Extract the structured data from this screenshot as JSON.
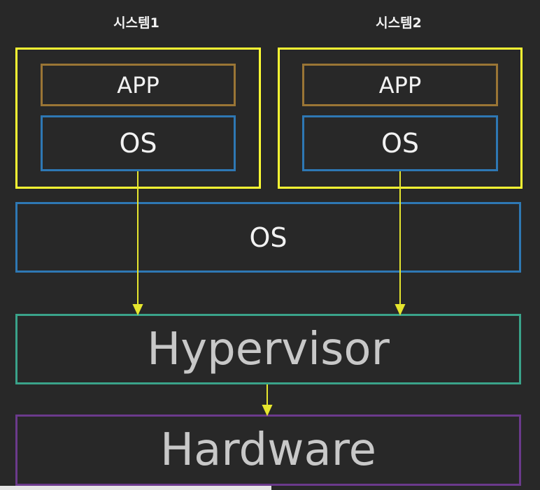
{
  "systems": [
    {
      "title": "시스템1",
      "app": "APP",
      "os": "OS"
    },
    {
      "title": "시스템2",
      "app": "APP",
      "os": "OS"
    }
  ],
  "host_os": "OS",
  "hypervisor": "Hypervisor",
  "hardware": "Hardware",
  "colors": {
    "background": "#282828",
    "system_border": "#ffff33",
    "app_border": "#9a7535",
    "os_border": "#2e78b4",
    "hypervisor_border": "#3aa38a",
    "hardware_border": "#6b3a8c",
    "arrow": "#e6e62e"
  }
}
